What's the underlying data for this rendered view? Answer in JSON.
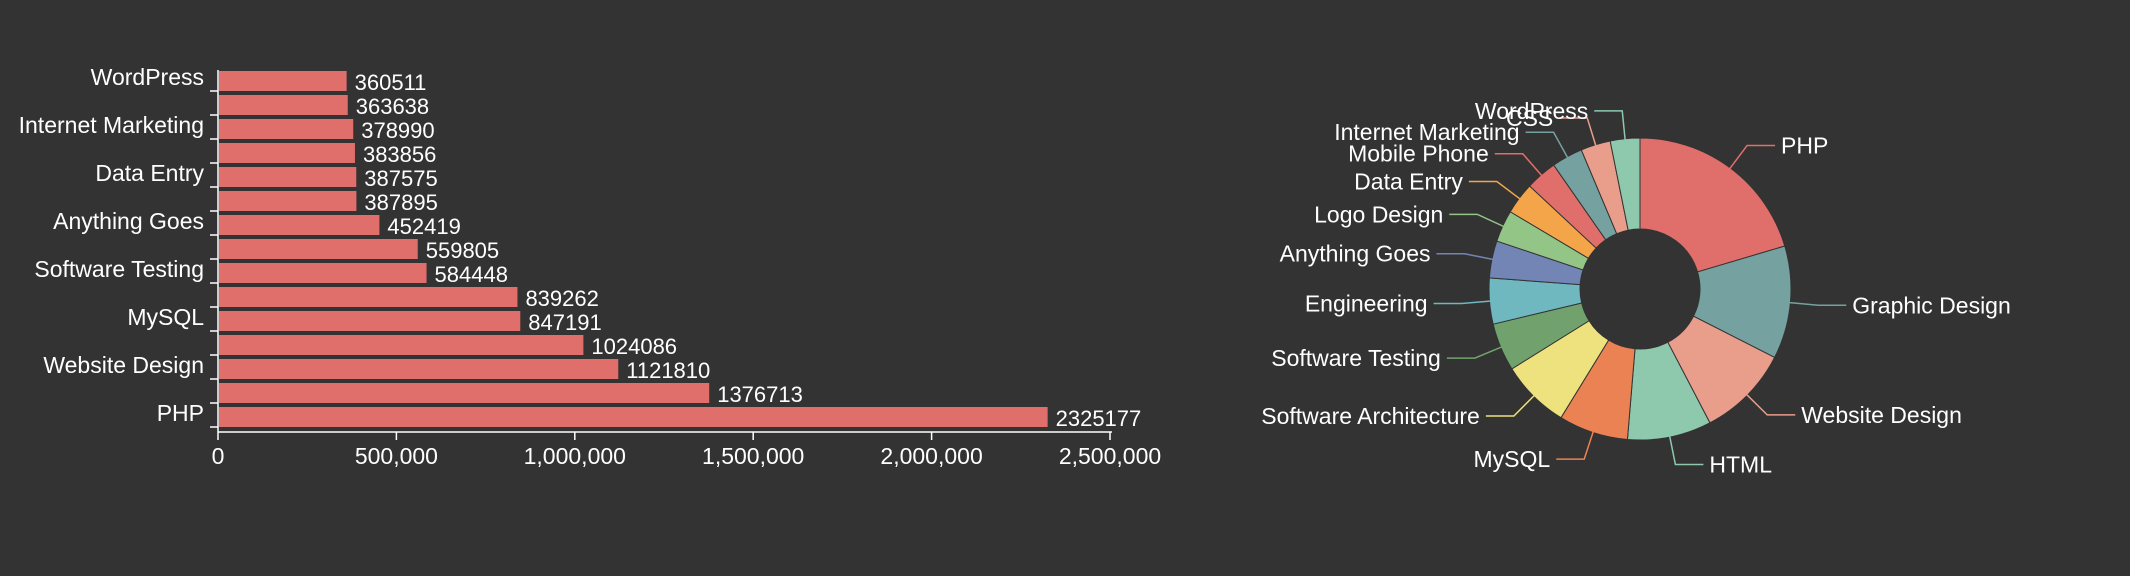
{
  "chart_data": [
    {
      "type": "bar",
      "orientation": "horizontal",
      "categories": [
        "WordPress",
        "",
        "Internet Marketing",
        "",
        "Data Entry",
        "",
        "Anything Goes",
        "",
        "Software Testing",
        "",
        "MySQL",
        "",
        "Website Design",
        "",
        "PHP"
      ],
      "values": [
        360511,
        363638,
        378990,
        383856,
        387575,
        387895,
        452419,
        559805,
        584448,
        839262,
        847191,
        1024086,
        1121810,
        1376713,
        2325177
      ],
      "value_labels": [
        "360511",
        "363638",
        "378990",
        "383856",
        "387575",
        "387895",
        "452419",
        "559805",
        "584448",
        "839262",
        "847191",
        "1024086",
        "1121810",
        "1376713",
        "2325177"
      ],
      "x_ticks": [
        "0",
        "500,000",
        "1,000,000",
        "1,500,000",
        "2,000,000",
        "2,500,000"
      ],
      "xlim": [
        0,
        2500000
      ],
      "bar_color": "#e06e6b"
    },
    {
      "type": "pie",
      "donut": true,
      "slices": [
        {
          "label": "PHP",
          "value": 2325177,
          "color": "#e06e6b"
        },
        {
          "label": "Graphic Design",
          "value": 1376713,
          "color": "#75a2a1"
        },
        {
          "label": "Website Design",
          "value": 1121810,
          "color": "#e99d8b"
        },
        {
          "label": "HTML",
          "value": 1024086,
          "color": "#8ec9ad"
        },
        {
          "label": "MySQL",
          "value": 847191,
          "color": "#ea8253"
        },
        {
          "label": "Software Architecture",
          "value": 839262,
          "color": "#ede27d"
        },
        {
          "label": "Software Testing",
          "value": 584448,
          "color": "#71a26d"
        },
        {
          "label": "Engineering",
          "value": 559805,
          "color": "#6fb8c0"
        },
        {
          "label": "Anything Goes",
          "value": 452419,
          "color": "#7385b5"
        },
        {
          "label": "Logo Design",
          "value": 387895,
          "color": "#93c686"
        },
        {
          "label": "Data Entry",
          "value": 387575,
          "color": "#f4a54a"
        },
        {
          "label": "Mobile Phone",
          "value": 383856,
          "color": "#e06e6b"
        },
        {
          "label": "Internet Marketing",
          "value": 378990,
          "color": "#75a2a1"
        },
        {
          "label": "CSS",
          "value": 363638,
          "color": "#e99d8b"
        },
        {
          "label": "WordPress",
          "value": 360511,
          "color": "#8ec9ad"
        }
      ]
    }
  ]
}
